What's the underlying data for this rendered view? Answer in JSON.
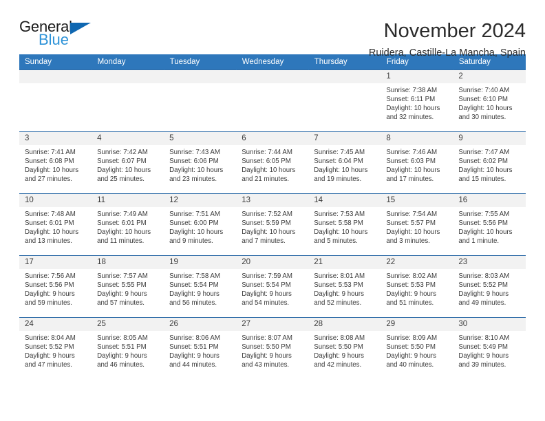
{
  "brand": {
    "name_part1": "General",
    "name_part2": "Blue",
    "accent_color": "#0f67b1",
    "accent_color_light": "#2e93d8"
  },
  "header": {
    "title": "November 2024",
    "subtitle": "Ruidera, Castille-La Mancha, Spain",
    "header_bg_color": "#2e77bb"
  },
  "calendar": {
    "weekday_headers": [
      "Sunday",
      "Monday",
      "Tuesday",
      "Wednesday",
      "Thursday",
      "Friday",
      "Saturday"
    ],
    "labels": {
      "sunrise": "Sunrise:",
      "sunset": "Sunset:",
      "daylight": "Daylight:"
    },
    "weeks": [
      [
        {
          "day": "",
          "sunrise": "",
          "sunset": "",
          "daylight_line1": "",
          "daylight_line2": ""
        },
        {
          "day": "",
          "sunrise": "",
          "sunset": "",
          "daylight_line1": "",
          "daylight_line2": ""
        },
        {
          "day": "",
          "sunrise": "",
          "sunset": "",
          "daylight_line1": "",
          "daylight_line2": ""
        },
        {
          "day": "",
          "sunrise": "",
          "sunset": "",
          "daylight_line1": "",
          "daylight_line2": ""
        },
        {
          "day": "",
          "sunrise": "",
          "sunset": "",
          "daylight_line1": "",
          "daylight_line2": ""
        },
        {
          "day": "1",
          "sunrise": "Sunrise: 7:38 AM",
          "sunset": "Sunset: 6:11 PM",
          "daylight_line1": "Daylight: 10 hours",
          "daylight_line2": "and 32 minutes."
        },
        {
          "day": "2",
          "sunrise": "Sunrise: 7:40 AM",
          "sunset": "Sunset: 6:10 PM",
          "daylight_line1": "Daylight: 10 hours",
          "daylight_line2": "and 30 minutes."
        }
      ],
      [
        {
          "day": "3",
          "sunrise": "Sunrise: 7:41 AM",
          "sunset": "Sunset: 6:08 PM",
          "daylight_line1": "Daylight: 10 hours",
          "daylight_line2": "and 27 minutes."
        },
        {
          "day": "4",
          "sunrise": "Sunrise: 7:42 AM",
          "sunset": "Sunset: 6:07 PM",
          "daylight_line1": "Daylight: 10 hours",
          "daylight_line2": "and 25 minutes."
        },
        {
          "day": "5",
          "sunrise": "Sunrise: 7:43 AM",
          "sunset": "Sunset: 6:06 PM",
          "daylight_line1": "Daylight: 10 hours",
          "daylight_line2": "and 23 minutes."
        },
        {
          "day": "6",
          "sunrise": "Sunrise: 7:44 AM",
          "sunset": "Sunset: 6:05 PM",
          "daylight_line1": "Daylight: 10 hours",
          "daylight_line2": "and 21 minutes."
        },
        {
          "day": "7",
          "sunrise": "Sunrise: 7:45 AM",
          "sunset": "Sunset: 6:04 PM",
          "daylight_line1": "Daylight: 10 hours",
          "daylight_line2": "and 19 minutes."
        },
        {
          "day": "8",
          "sunrise": "Sunrise: 7:46 AM",
          "sunset": "Sunset: 6:03 PM",
          "daylight_line1": "Daylight: 10 hours",
          "daylight_line2": "and 17 minutes."
        },
        {
          "day": "9",
          "sunrise": "Sunrise: 7:47 AM",
          "sunset": "Sunset: 6:02 PM",
          "daylight_line1": "Daylight: 10 hours",
          "daylight_line2": "and 15 minutes."
        }
      ],
      [
        {
          "day": "10",
          "sunrise": "Sunrise: 7:48 AM",
          "sunset": "Sunset: 6:01 PM",
          "daylight_line1": "Daylight: 10 hours",
          "daylight_line2": "and 13 minutes."
        },
        {
          "day": "11",
          "sunrise": "Sunrise: 7:49 AM",
          "sunset": "Sunset: 6:01 PM",
          "daylight_line1": "Daylight: 10 hours",
          "daylight_line2": "and 11 minutes."
        },
        {
          "day": "12",
          "sunrise": "Sunrise: 7:51 AM",
          "sunset": "Sunset: 6:00 PM",
          "daylight_line1": "Daylight: 10 hours",
          "daylight_line2": "and 9 minutes."
        },
        {
          "day": "13",
          "sunrise": "Sunrise: 7:52 AM",
          "sunset": "Sunset: 5:59 PM",
          "daylight_line1": "Daylight: 10 hours",
          "daylight_line2": "and 7 minutes."
        },
        {
          "day": "14",
          "sunrise": "Sunrise: 7:53 AM",
          "sunset": "Sunset: 5:58 PM",
          "daylight_line1": "Daylight: 10 hours",
          "daylight_line2": "and 5 minutes."
        },
        {
          "day": "15",
          "sunrise": "Sunrise: 7:54 AM",
          "sunset": "Sunset: 5:57 PM",
          "daylight_line1": "Daylight: 10 hours",
          "daylight_line2": "and 3 minutes."
        },
        {
          "day": "16",
          "sunrise": "Sunrise: 7:55 AM",
          "sunset": "Sunset: 5:56 PM",
          "daylight_line1": "Daylight: 10 hours",
          "daylight_line2": "and 1 minute."
        }
      ],
      [
        {
          "day": "17",
          "sunrise": "Sunrise: 7:56 AM",
          "sunset": "Sunset: 5:56 PM",
          "daylight_line1": "Daylight: 9 hours",
          "daylight_line2": "and 59 minutes."
        },
        {
          "day": "18",
          "sunrise": "Sunrise: 7:57 AM",
          "sunset": "Sunset: 5:55 PM",
          "daylight_line1": "Daylight: 9 hours",
          "daylight_line2": "and 57 minutes."
        },
        {
          "day": "19",
          "sunrise": "Sunrise: 7:58 AM",
          "sunset": "Sunset: 5:54 PM",
          "daylight_line1": "Daylight: 9 hours",
          "daylight_line2": "and 56 minutes."
        },
        {
          "day": "20",
          "sunrise": "Sunrise: 7:59 AM",
          "sunset": "Sunset: 5:54 PM",
          "daylight_line1": "Daylight: 9 hours",
          "daylight_line2": "and 54 minutes."
        },
        {
          "day": "21",
          "sunrise": "Sunrise: 8:01 AM",
          "sunset": "Sunset: 5:53 PM",
          "daylight_line1": "Daylight: 9 hours",
          "daylight_line2": "and 52 minutes."
        },
        {
          "day": "22",
          "sunrise": "Sunrise: 8:02 AM",
          "sunset": "Sunset: 5:53 PM",
          "daylight_line1": "Daylight: 9 hours",
          "daylight_line2": "and 51 minutes."
        },
        {
          "day": "23",
          "sunrise": "Sunrise: 8:03 AM",
          "sunset": "Sunset: 5:52 PM",
          "daylight_line1": "Daylight: 9 hours",
          "daylight_line2": "and 49 minutes."
        }
      ],
      [
        {
          "day": "24",
          "sunrise": "Sunrise: 8:04 AM",
          "sunset": "Sunset: 5:52 PM",
          "daylight_line1": "Daylight: 9 hours",
          "daylight_line2": "and 47 minutes."
        },
        {
          "day": "25",
          "sunrise": "Sunrise: 8:05 AM",
          "sunset": "Sunset: 5:51 PM",
          "daylight_line1": "Daylight: 9 hours",
          "daylight_line2": "and 46 minutes."
        },
        {
          "day": "26",
          "sunrise": "Sunrise: 8:06 AM",
          "sunset": "Sunset: 5:51 PM",
          "daylight_line1": "Daylight: 9 hours",
          "daylight_line2": "and 44 minutes."
        },
        {
          "day": "27",
          "sunrise": "Sunrise: 8:07 AM",
          "sunset": "Sunset: 5:50 PM",
          "daylight_line1": "Daylight: 9 hours",
          "daylight_line2": "and 43 minutes."
        },
        {
          "day": "28",
          "sunrise": "Sunrise: 8:08 AM",
          "sunset": "Sunset: 5:50 PM",
          "daylight_line1": "Daylight: 9 hours",
          "daylight_line2": "and 42 minutes."
        },
        {
          "day": "29",
          "sunrise": "Sunrise: 8:09 AM",
          "sunset": "Sunset: 5:50 PM",
          "daylight_line1": "Daylight: 9 hours",
          "daylight_line2": "and 40 minutes."
        },
        {
          "day": "30",
          "sunrise": "Sunrise: 8:10 AM",
          "sunset": "Sunset: 5:49 PM",
          "daylight_line1": "Daylight: 9 hours",
          "daylight_line2": "and 39 minutes."
        }
      ]
    ]
  }
}
